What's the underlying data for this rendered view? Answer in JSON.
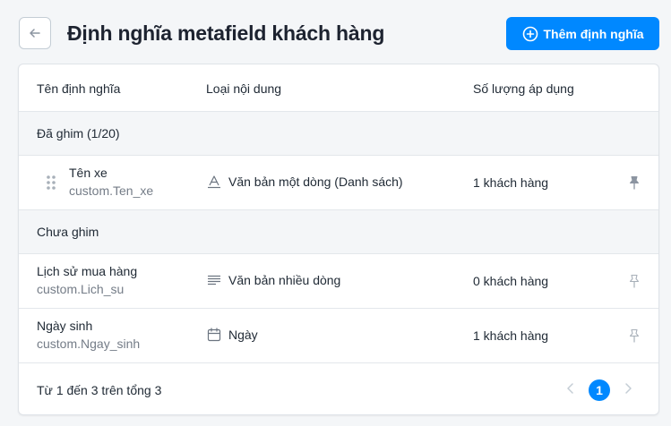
{
  "page": {
    "title": "Định nghĩa metafield khách hàng",
    "add_button_label": "Thêm định nghĩa"
  },
  "table": {
    "headers": [
      "Tên định nghĩa",
      "Loại nội dung",
      "Số lượng áp dụng"
    ],
    "groups": [
      {
        "label": "Đã ghim (1/20)",
        "rows": [
          {
            "name": "Tên xe",
            "key": "custom.Ten_xe",
            "type": "Văn bản một dòng (Danh sách)",
            "type_icon": "single-line-text-icon",
            "count": "1 khách hàng",
            "pinned": true
          }
        ]
      },
      {
        "label": "Chưa ghim",
        "rows": [
          {
            "name": "Lịch sử mua hàng",
            "key": "custom.Lich_su",
            "type": "Văn bản nhiều dòng",
            "type_icon": "multi-line-text-icon",
            "count": "0 khách hàng",
            "pinned": false
          },
          {
            "name": "Ngày sinh",
            "key": "custom.Ngay_sinh",
            "type": "Ngày",
            "type_icon": "calendar-icon",
            "count": "1 khách hàng",
            "pinned": false
          }
        ]
      }
    ]
  },
  "footer": {
    "summary": "Từ 1 đến 3 trên tổng 3",
    "current_page": "1"
  },
  "colors": {
    "primary": "#0088ff",
    "group_background": "#f4f6f8",
    "muted_text": "#747c87"
  }
}
